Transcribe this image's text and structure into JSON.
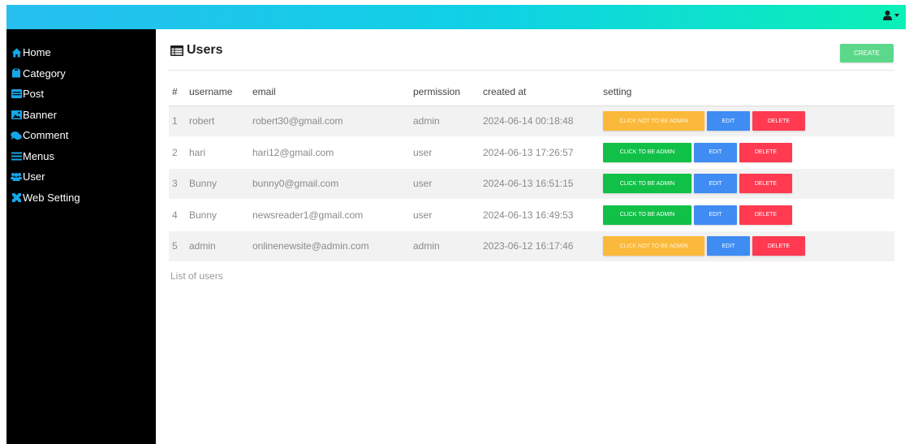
{
  "topbar": {
    "user_menu_icon": "user-icon",
    "caret_icon": "caret-down-icon"
  },
  "sidebar": {
    "items": [
      {
        "label": "Home",
        "icon": "home-icon"
      },
      {
        "label": "Category",
        "icon": "tag-icon"
      },
      {
        "label": "Post",
        "icon": "list-icon"
      },
      {
        "label": "Banner",
        "icon": "image-icon"
      },
      {
        "label": "Comment",
        "icon": "comments-icon"
      },
      {
        "label": "Menus",
        "icon": "bars-icon"
      },
      {
        "label": "User",
        "icon": "users-icon"
      },
      {
        "label": "Web Setting",
        "icon": "tools-icon"
      }
    ]
  },
  "page": {
    "title": "Users",
    "title_icon": "table-icon",
    "create_label": "CREATE"
  },
  "table": {
    "headers": {
      "index": "#",
      "username": "username",
      "email": "email",
      "permission": "permission",
      "created_at": "created at",
      "setting": "setting"
    },
    "rows": [
      {
        "index": "1",
        "username": "robert",
        "email": "robert30@gmail.com",
        "permission": "admin",
        "created_at": "2024-06-14 00:18:48",
        "toggle_label": "CLICK NOT TO BE ADMIN",
        "edit_label": "EDIT",
        "delete_label": "DELETE"
      },
      {
        "index": "2",
        "username": "hari",
        "email": "hari12@gmail.com",
        "permission": "user",
        "created_at": "2024-06-13 17:26:57",
        "toggle_label": "CLICK TO BE ADMIN",
        "edit_label": "EDIT",
        "delete_label": "DELETE"
      },
      {
        "index": "3",
        "username": "Bunny",
        "email": "bunny0@gmail.com",
        "permission": "user",
        "created_at": "2024-06-13 16:51:15",
        "toggle_label": "CLICK TO BE ADMIN",
        "edit_label": "EDIT",
        "delete_label": "DELETE"
      },
      {
        "index": "4",
        "username": "Bunny",
        "email": "newsreader1@gmail.com",
        "permission": "user",
        "created_at": "2024-06-13 16:49:53",
        "toggle_label": "CLICK TO BE ADMIN",
        "edit_label": "EDIT",
        "delete_label": "DELETE"
      },
      {
        "index": "5",
        "username": "admin",
        "email": "onlinenewsite@admin.com",
        "permission": "admin",
        "created_at": "2023-06-12 16:17:46",
        "toggle_label": "CLICK NOT TO BE ADMIN",
        "edit_label": "EDIT",
        "delete_label": "DELETE"
      }
    ],
    "caption": "List of users"
  },
  "colors": {
    "topbar_start": "#27bff0",
    "topbar_end": "#0bf0b6",
    "sidebar_icon": "#16a6e8",
    "create": "#5cd88a",
    "not_admin": "#fbb93b",
    "to_admin": "#11c147",
    "edit": "#3f8cf3",
    "delete": "#ff3a51"
  }
}
